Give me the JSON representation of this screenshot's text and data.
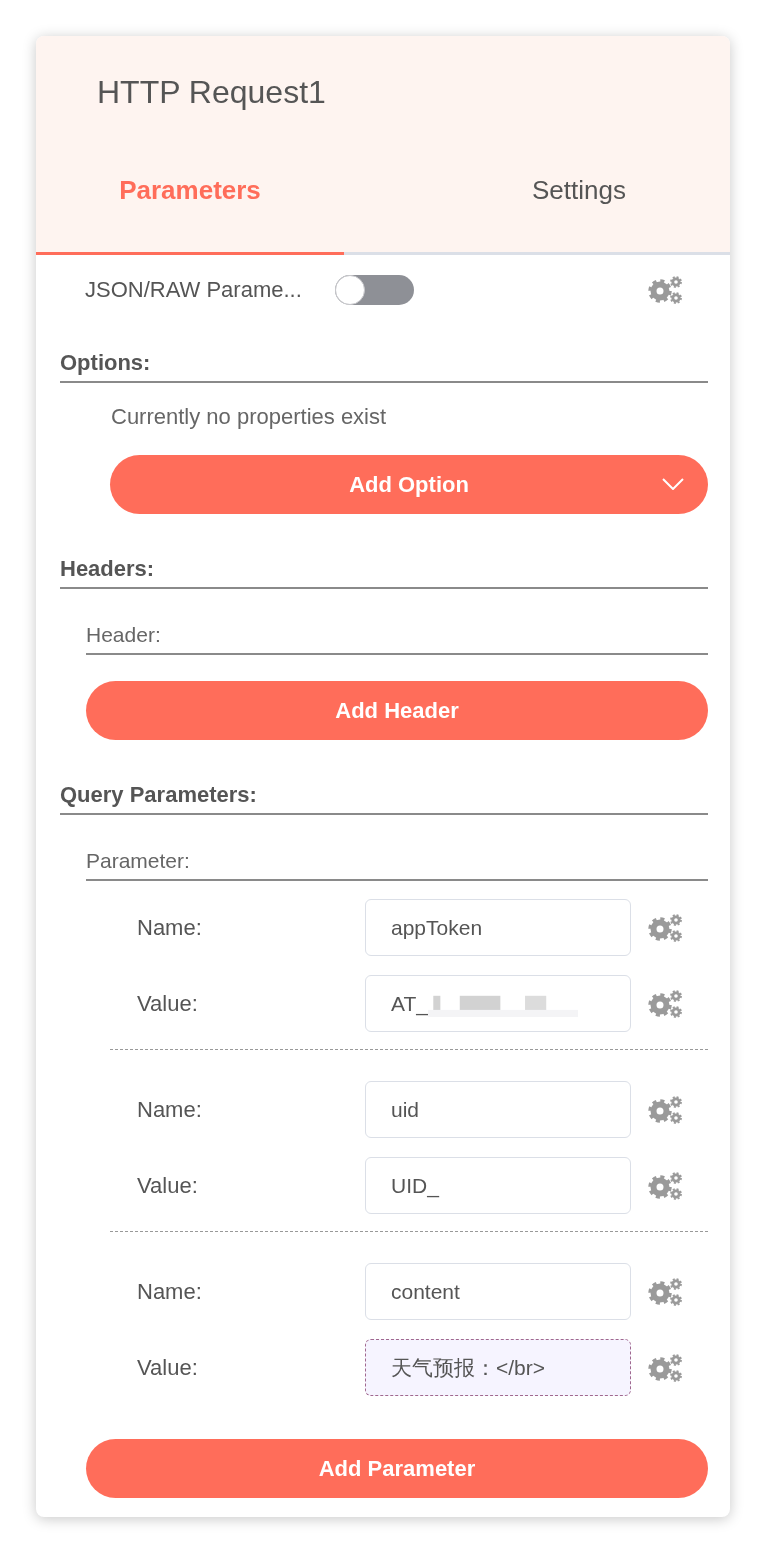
{
  "window": {
    "title": "HTTP Request1"
  },
  "tabs": [
    {
      "label": "Parameters",
      "selected": true
    },
    {
      "label": "Settings",
      "selected": false
    }
  ],
  "json_raw_parameters": {
    "label": "JSON/RAW Parame...",
    "on": false
  },
  "sections": [
    {
      "kind": "options",
      "title": "Options:",
      "empty_text": "Currently no properties exist",
      "button": "Add Option"
    },
    {
      "kind": "collection",
      "title": "Headers:",
      "collection_label": "Header:",
      "button": "Add Header"
    },
    {
      "kind": "collection",
      "title": "Query Parameters:",
      "collection_label": "Parameter:",
      "parameters": [
        {
          "fields": [
            {
              "label": "Name:",
              "value": "appToken",
              "kind": "text",
              "redacted": false
            },
            {
              "label": "Value:",
              "value": "AT_",
              "kind": "text",
              "redacted": true
            }
          ]
        },
        {
          "fields": [
            {
              "label": "Name:",
              "value": "uid",
              "kind": "text",
              "redacted": false
            },
            {
              "label": "Value:",
              "value": "UID_",
              "kind": "text",
              "redacted": false
            }
          ]
        },
        {
          "fields": [
            {
              "label": "Name:",
              "value": "content",
              "kind": "text",
              "redacted": false
            },
            {
              "label": "Value:",
              "value": "天气预报：</br>",
              "kind": "expression",
              "redacted": false
            }
          ]
        }
      ],
      "button": "Add Parameter"
    }
  ]
}
